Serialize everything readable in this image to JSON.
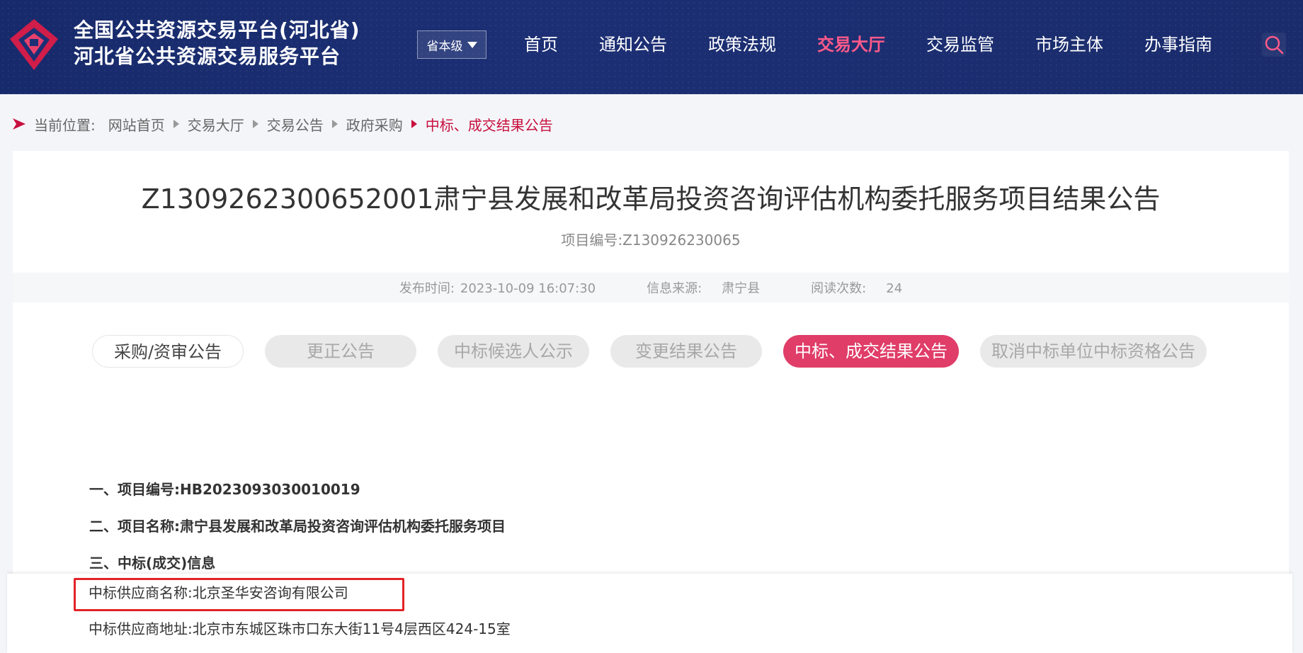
{
  "header": {
    "logo_line1": "全国公共资源交易平台(河北省)",
    "logo_line2": "河北省公共资源交易服务平台",
    "level_select": "省本级",
    "nav": [
      {
        "label": "首页",
        "active": false
      },
      {
        "label": "通知公告",
        "active": false
      },
      {
        "label": "政策法规",
        "active": false
      },
      {
        "label": "交易大厅",
        "active": true
      },
      {
        "label": "交易监管",
        "active": false
      },
      {
        "label": "市场主体",
        "active": false
      },
      {
        "label": "办事指南",
        "active": false
      }
    ],
    "accent_color": "#ff5a8a"
  },
  "breadcrumb": {
    "prefix": "当前位置:",
    "items": [
      "网站首页",
      "交易大厅",
      "交易公告",
      "政府采购",
      "中标、成交结果公告"
    ]
  },
  "article": {
    "title": "Z1309262300652001肃宁县发展和改革局投资咨询评估机构委托服务项目结果公告",
    "project_code": "项目编号:Z130926230065",
    "publish_label": "发布时间:",
    "publish_value": "2023-10-09 16:07:30",
    "source_label": "信息来源:",
    "source_value": "肃宁县",
    "views_label": "阅读次数:",
    "views_value": "24"
  },
  "tabs": [
    {
      "label": "采购/资审公告",
      "style": "outlined"
    },
    {
      "label": "更正公告",
      "style": "grey"
    },
    {
      "label": "中标候选人公示",
      "style": "grey"
    },
    {
      "label": "变更结果公告",
      "style": "grey"
    },
    {
      "label": "中标、成交结果公告",
      "style": "active"
    },
    {
      "label": "取消中标单位中标资格公告",
      "style": "grey"
    }
  ],
  "body": {
    "section1": "一、项目编号:HB2023093030010019",
    "section2": "二、项目名称:肃宁县发展和改革局投资咨询评估机构委托服务项目",
    "section3": "三、中标(成交)信息",
    "supplier_name": "中标供应商名称:北京圣华安咨询有限公司",
    "supplier_address": "中标供应商地址:北京市东城区珠市口东大街11号4层西区424-15室"
  },
  "colors": {
    "header_bg": "#1c2f74",
    "active_tab": "#e03d68",
    "breadcrumb_current": "#c8103e",
    "highlight_box": "#e22328"
  }
}
